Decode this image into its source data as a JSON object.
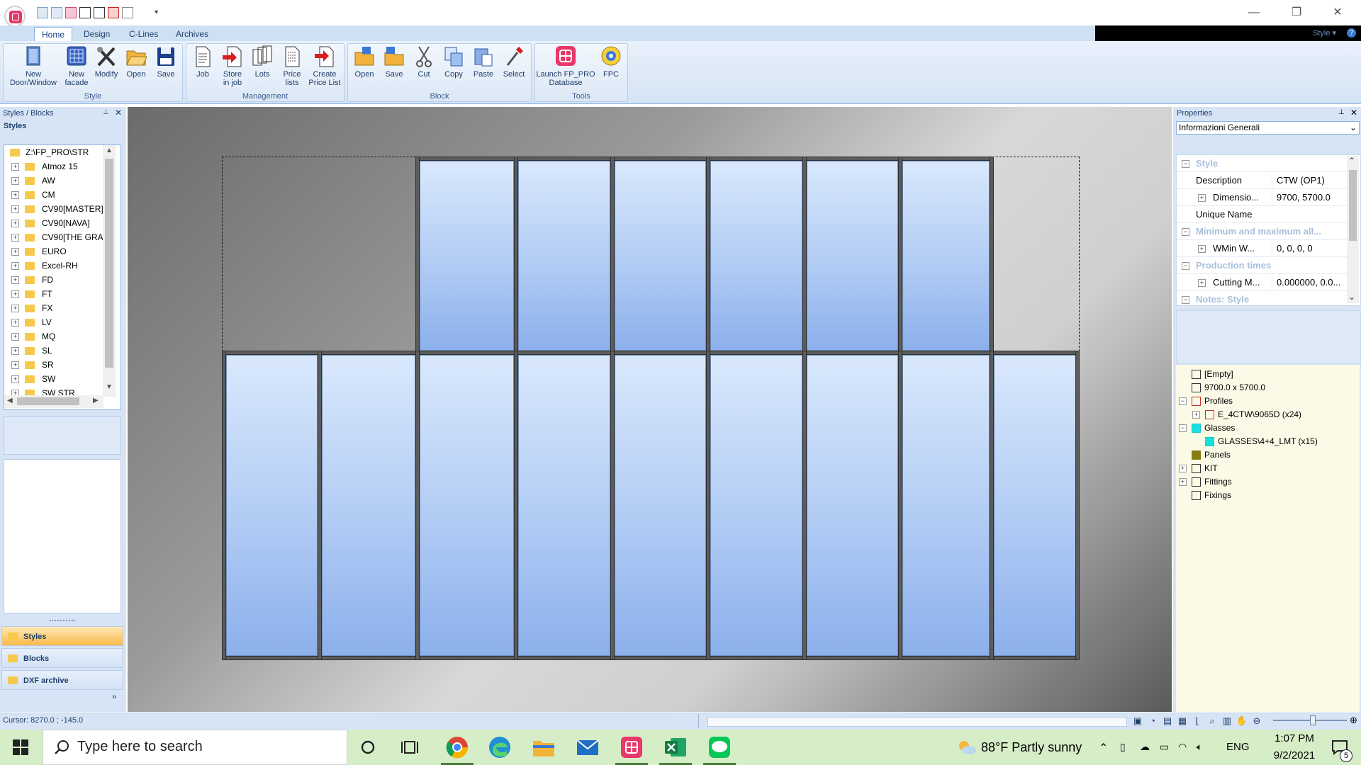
{
  "ribbon": {
    "tabs": [
      "Home",
      "Design",
      "C-Lines",
      "Archives"
    ],
    "style_dropdown": "Style",
    "groups": {
      "style": {
        "label": "Style",
        "buttons": [
          {
            "line1": "New",
            "line2": "Door/Window"
          },
          {
            "line1": "New",
            "line2": "facade"
          },
          {
            "line1": "Modify",
            "line2": ""
          },
          {
            "line1": "Open",
            "line2": ""
          },
          {
            "line1": "Save",
            "line2": ""
          }
        ]
      },
      "management": {
        "label": "Management",
        "buttons": [
          {
            "line1": "Job",
            "line2": ""
          },
          {
            "line1": "Store",
            "line2": "in job"
          },
          {
            "line1": "Lots",
            "line2": ""
          },
          {
            "line1": "Price",
            "line2": "lists"
          },
          {
            "line1": "Create",
            "line2": "Price List"
          }
        ]
      },
      "block": {
        "label": "Block",
        "buttons": [
          {
            "line1": "Open",
            "line2": ""
          },
          {
            "line1": "Save",
            "line2": ""
          },
          {
            "line1": "Cut",
            "line2": ""
          },
          {
            "line1": "Copy",
            "line2": ""
          },
          {
            "line1": "Paste",
            "line2": ""
          },
          {
            "line1": "Select",
            "line2": ""
          }
        ]
      },
      "tools": {
        "label": "Tools",
        "buttons": [
          {
            "line1": "Launch FP_PRO",
            "line2": "Database"
          },
          {
            "line1": "FPC",
            "line2": ""
          }
        ]
      }
    }
  },
  "left_panel": {
    "title": "Styles / Blocks",
    "section": "Styles",
    "root": "Z:\\FP_PRO\\STR",
    "items": [
      "Atmoz 15",
      "AW",
      "CM",
      "CV90[MASTER]",
      "CV90[NAVA]",
      "CV90[THE GRA",
      "EURO",
      "Excel-RH",
      "FD",
      "FT",
      "FX",
      "LV",
      "MQ",
      "SL",
      "SR",
      "SW",
      "SW STR"
    ],
    "nav": [
      "Styles",
      "Blocks",
      "DXF archive"
    ]
  },
  "properties": {
    "title": "Properties",
    "selector": "Informazioni Generali",
    "rows": [
      {
        "type": "category",
        "label": "Style"
      },
      {
        "type": "prop",
        "key": "Description",
        "value": "CTW (OP1)",
        "expand": false
      },
      {
        "type": "prop",
        "key": "Dimensio...",
        "value": "9700, 5700.0",
        "expand": true
      },
      {
        "type": "prop",
        "key": "Unique Name",
        "value": "",
        "expand": false
      },
      {
        "type": "category",
        "label": "Minimum and maximum all..."
      },
      {
        "type": "prop",
        "key": "WMin W...",
        "value": "0, 0, 0, 0",
        "expand": true
      },
      {
        "type": "category",
        "label": "Production times"
      },
      {
        "type": "prop",
        "key": "Cutting M...",
        "value": "0.000000, 0.0...",
        "expand": true
      },
      {
        "type": "category",
        "label": "Notes: Style"
      }
    ],
    "tree": [
      {
        "label": "[Empty]",
        "indent": 1,
        "expander": ""
      },
      {
        "label": "9700.0 x 5700.0",
        "indent": 1,
        "expander": ""
      },
      {
        "label": "Profiles",
        "indent": 1,
        "expander": "-"
      },
      {
        "label": "E_4CTW\\9065D (x24)",
        "indent": 2,
        "expander": "+"
      },
      {
        "label": "Glasses",
        "indent": 1,
        "expander": "-"
      },
      {
        "label": "GLASSES\\4+4_LMT (x15)",
        "indent": 2,
        "expander": ""
      },
      {
        "label": "Panels",
        "indent": 1,
        "expander": ""
      },
      {
        "label": "KIT",
        "indent": 1,
        "expander": "+"
      },
      {
        "label": "Fittings",
        "indent": 1,
        "expander": "+"
      },
      {
        "label": "Fixings",
        "indent": 1,
        "expander": ""
      }
    ]
  },
  "status": {
    "cursor": "Cursor:   8270.0 ; -145.0"
  },
  "taskbar": {
    "search_placeholder": "Type here to search",
    "weather": "88°F  Partly sunny",
    "language": "ENG",
    "time": "1:07 PM",
    "date": "9/2/2021",
    "notifications": "5"
  }
}
